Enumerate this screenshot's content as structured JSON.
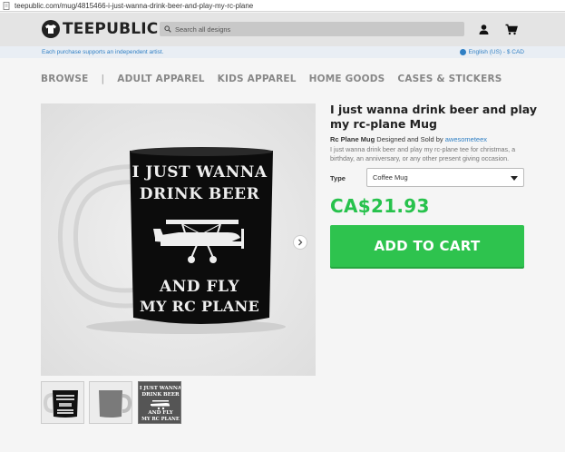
{
  "browser": {
    "url": "teepublic.com/mug/4815466-i-just-wanna-drink-beer-and-play-my-rc-plane"
  },
  "header": {
    "logo_text": "TEEPUBLIC",
    "search_placeholder": "Search all designs"
  },
  "substrip": {
    "support_text": "Each purchase supports an independent artist.",
    "locale_text": "English (US) - $ CAD"
  },
  "nav": {
    "items": [
      "BROWSE",
      "ADULT APPAREL",
      "KIDS APPAREL",
      "HOME GOODS",
      "CASES & STICKERS"
    ],
    "separator": "|"
  },
  "product": {
    "title": "I just wanna drink beer and play my rc-plane Mug",
    "product_name": "Rc Plane Mug",
    "designed_by_text": " Designed and Sold by ",
    "artist": "awesometeex",
    "description": "I just wanna drink beer and play my rc-plane tee for christmas, a birthday, an anniversary, or any other present giving occasion.",
    "type_label": "Type",
    "type_value": "Coffee Mug",
    "price": "CA$21.93",
    "cart_button": "ADD TO CART"
  },
  "mug_art": {
    "line1": "I JUST WANNA",
    "line2": "DRINK BEER",
    "line3": "AND FLY",
    "line4": "MY RC PLANE"
  },
  "colors": {
    "accent_green": "#2ec34e",
    "link_blue": "#2f7fc4"
  }
}
